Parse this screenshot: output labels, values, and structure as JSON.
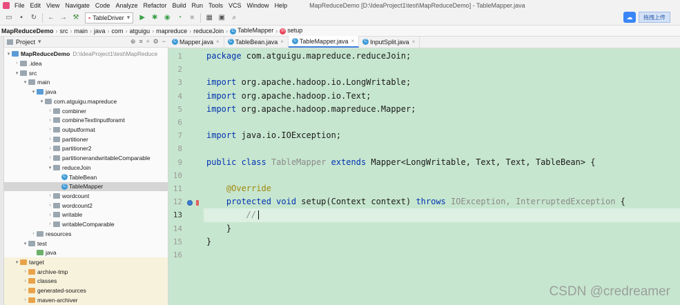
{
  "menubar": {
    "items": [
      "File",
      "Edit",
      "View",
      "Navigate",
      "Code",
      "Analyze",
      "Refactor",
      "Build",
      "Run",
      "Tools",
      "VCS",
      "Window",
      "Help"
    ],
    "window_title": "MapReduceDemo [D:\\IdeaProject1\\test\\MapReduceDemo] - TableMapper.java"
  },
  "toolbar": {
    "run_config": "TableDriver",
    "upload_label": "拖拽上传"
  },
  "breadcrumb": {
    "items": [
      "MapReduceDemo",
      "src",
      "main",
      "java",
      "com",
      "atguigu",
      "mapreduce",
      "reduceJoin",
      "TableMapper",
      "setup"
    ]
  },
  "project_panel": {
    "title": "Project",
    "tree": [
      {
        "label": "MapReduceDemo",
        "path": "D:\\IdeaProject1\\test\\MapReduce",
        "bold": true
      },
      {
        "label": ".idea"
      },
      {
        "label": "src"
      },
      {
        "label": "main"
      },
      {
        "label": "java"
      },
      {
        "label": "com.atguigu.mapreduce"
      },
      {
        "label": "combiner"
      },
      {
        "label": "combineTextInputforamt"
      },
      {
        "label": "outputformat"
      },
      {
        "label": "partitioner"
      },
      {
        "label": "partitioner2"
      },
      {
        "label": "partitionerandwritableComparable"
      },
      {
        "label": "reduceJoin"
      },
      {
        "label": "TableBean"
      },
      {
        "label": "TableMapper"
      },
      {
        "label": "wordcount"
      },
      {
        "label": "wordcount2"
      },
      {
        "label": "writable"
      },
      {
        "label": "writableComparable"
      },
      {
        "label": "resources"
      },
      {
        "label": "test"
      },
      {
        "label": "java"
      },
      {
        "label": "target"
      },
      {
        "label": "archive-tmp"
      },
      {
        "label": "classes"
      },
      {
        "label": "generated-sources"
      },
      {
        "label": "maven-archiver"
      }
    ]
  },
  "tabs": [
    "Mapper.java",
    "TableBean.java",
    "TableMapper.java",
    "InputSplit.java"
  ],
  "active_tab": "TableMapper.java",
  "editor": {
    "line_numbers": [
      "1",
      "2",
      "3",
      "4",
      "5",
      "6",
      "7",
      "8",
      "9",
      "10",
      "11",
      "12",
      "13",
      "14",
      "15",
      "16"
    ],
    "current_line": "13",
    "code": {
      "l1_kw": "package",
      "l1_rest": " com.atguigu.mapreduce.reduceJoin;",
      "l3_kw": "import",
      "l3_rest": " org.apache.hadoop.io.LongWritable;",
      "l4_kw": "import",
      "l4_rest": " org.apache.hadoop.io.Text;",
      "l5_kw": "import",
      "l5_rest": " org.apache.hadoop.mapreduce.Mapper;",
      "l7_kw": "import",
      "l7_rest": " java.io.IOException;",
      "l9_kw1": "public class",
      "l9_name": " TableMapper ",
      "l9_kw2": "extends",
      "l9_rest": " Mapper<LongWritable, Text, Text, TableBean> {",
      "l11_ann": "    @Override",
      "l12_kw1": "    protected void",
      "l12_mid": " setup(Context context) ",
      "l12_kw2": "throws",
      "l12_ex": " IOException, InterruptedException",
      "l12_end": " {",
      "l13_cmt": "        //",
      "l14": "    }",
      "l15": "}"
    }
  },
  "watermark": "CSDN @credreamer"
}
